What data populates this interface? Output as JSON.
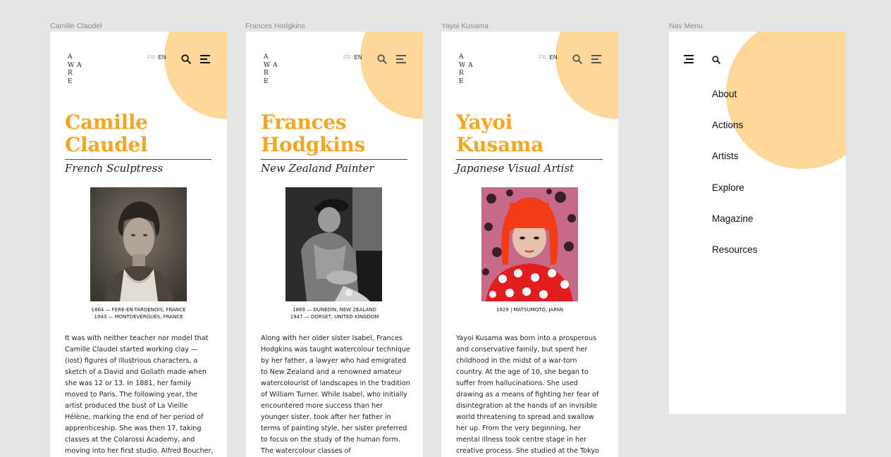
{
  "frames": {
    "camille": {
      "label": "Camille Claudel",
      "logo": [
        "A",
        "W A",
        "R",
        "E"
      ],
      "lang": {
        "fr": "FR",
        "en": "EN"
      },
      "name_line1": "Camille",
      "name_line2": "Claudel",
      "subtitle": "French Sculptress",
      "caption_line1": "1864 — FÈRE-EN-TARDENOIS, FRANCE",
      "caption_line2": "1943 — MONTDEVERGUES, FRANCE",
      "body": "It was with neither teacher nor model that Camille Claudel started working clay —(lost) figures of illustrious characters, a sketch of a David and Goliath made when she was 12 or 13. In 1881, her family moved to Paris. The following year, the artist produced the bust of La Vieille Hélène, marking the end of her period of apprenticeship. She was then 17, taking classes at the Colarossi Academy, and moving into her first studio. Alfred Boucher,"
    },
    "frances": {
      "label": "Frances Hodgkins",
      "logo": [
        "A",
        "W A",
        "R",
        "E"
      ],
      "lang": {
        "fr": "FR",
        "en": "EN"
      },
      "name_line1": "Frances",
      "name_line2": "Hodgkins",
      "subtitle": "New Zealand Painter",
      "caption_line1": "1869 — DUNEDIN, NEW ZEALAND",
      "caption_line2": "1947 — DORSET, UNITED KINGDOM",
      "body": "Along with her older sister Isabel, Frances Hodgkins was taught watercolour technique by her father, a lawyer who had emigrated to New Zealand and a renowned amateur watercolourist of landscapes in the tradition of William Turner. While Isabel, who initially encountered more success than her younger sister, took after her father in terms of painting style, her sister preferred to focus on the study of the human form. The watercolour classes of"
    },
    "yayoi": {
      "label": "Yayoi Kusama",
      "logo": [
        "A",
        "W A",
        "R",
        "E"
      ],
      "lang": {
        "fr": "FR",
        "en": "EN"
      },
      "name_line1": "Yayoi",
      "name_line2": "Kusama",
      "subtitle": "Japanese Visual Artist",
      "caption_line1": "1929 | MATSUMOTO, JAPAN",
      "body": "Yayoi Kusama was born into a prosperous and conservative family, but spent her childhood in the midst of a war-torn country. At the age of 10, she began to suffer from hallucinations. She used drawing as a means of fighting her fear of disintegration at the hands of an invisible world threatening to spread and swallow her up. From the very beginning, her mental illness took centre stage in her creative process. She studied at the Tokyo"
    },
    "nav": {
      "label": "Nav Menu",
      "items": [
        "About",
        "Actions",
        "Artists",
        "Explore",
        "Magazine",
        "Resources"
      ]
    }
  },
  "icons": {
    "search": "search-icon",
    "menu": "hamburger-menu-icon"
  },
  "colors": {
    "accent": "#f5a623",
    "circle": "#fed899",
    "background": "#e5e5e5"
  }
}
